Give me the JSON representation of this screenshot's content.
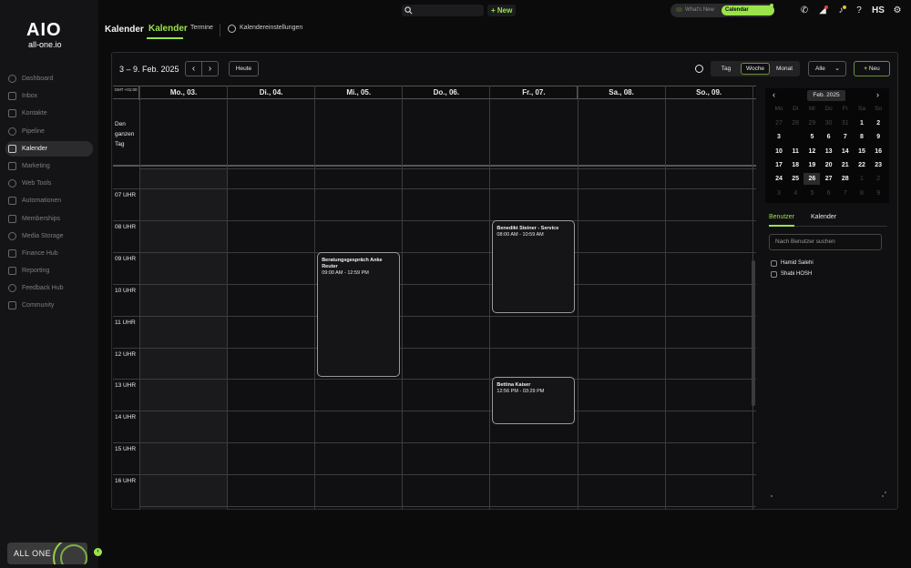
{
  "topbar": {
    "new_label": "+ New",
    "whats_new": "What's New",
    "calendar_updates": "Calendar Updates",
    "user_initials": "HS"
  },
  "sidebar": {
    "logo": "AIO",
    "logo_text": "all-one.io",
    "items": [
      {
        "label": "Dashboard",
        "icon": "dashboard-icon"
      },
      {
        "label": "Inbox",
        "icon": "inbox-icon"
      },
      {
        "label": "Kontakte",
        "icon": "contacts-icon"
      },
      {
        "label": "Pipeline",
        "icon": "pipeline-icon"
      },
      {
        "label": "Kalender",
        "icon": "calendar-icon",
        "active": true
      },
      {
        "label": "Marketing",
        "icon": "marketing-icon"
      },
      {
        "label": "Web Tools",
        "icon": "web-tools-icon"
      },
      {
        "label": "Automationen",
        "icon": "automation-icon"
      },
      {
        "label": "Memberships",
        "icon": "memberships-icon"
      },
      {
        "label": "Media Storage",
        "icon": "media-storage-icon"
      },
      {
        "label": "Finance Hub",
        "icon": "finance-icon"
      },
      {
        "label": "Reporting",
        "icon": "reporting-icon"
      },
      {
        "label": "Feedback Hub",
        "icon": "feedback-icon"
      },
      {
        "label": "Community",
        "icon": "community-icon"
      }
    ],
    "brand_footer": "ALL ONE"
  },
  "subnav": {
    "title": "Kalender",
    "tabs": [
      "Kalender",
      "Termine",
      "Kalendereinstellungen"
    ]
  },
  "toolbar": {
    "date_range": "3 – 9. Feb. 2025",
    "today": "Heute",
    "views": [
      "Tag",
      "Woche",
      "Monat"
    ],
    "active_view": "Woche",
    "filter": "Alle",
    "new": "Neu"
  },
  "grid": {
    "timezone": "GMT +01:00",
    "days": [
      "Mo., 03.",
      "Di., 04.",
      "Mi., 05.",
      "Do., 06.",
      "Fr., 07.",
      "Sa., 08.",
      "So., 09."
    ],
    "allday_label": "Den ganzen Tag",
    "hours": [
      "07 UHR",
      "08 UHR",
      "09 UHR",
      "10 UHR",
      "11 UHR",
      "12 UHR",
      "13 UHR",
      "14 UHR",
      "15 UHR",
      "16 UHR"
    ],
    "events": [
      {
        "title": "Beratungsgespräch Anke Reuter",
        "time": "09:00 AM - 12:59 PM",
        "day": "Mi., 05."
      },
      {
        "title": "Benedikt Steiner - Service",
        "time": "08:00 AM - 10:59 AM",
        "day": "Fr., 07."
      },
      {
        "title": "Bettina Kaiser",
        "time": "12:56 PM - 03:29 PM",
        "day": "Fr., 07."
      }
    ]
  },
  "mini_calendar": {
    "month": "Feb. 2025",
    "weekdays": [
      "Mo",
      "Di",
      "Mi",
      "Do",
      "Fr",
      "Sa",
      "So"
    ],
    "weeks": [
      [
        "27",
        "28",
        "29",
        "30",
        "31",
        "1",
        "2"
      ],
      [
        "3",
        "4",
        "5",
        "6",
        "7",
        "8",
        "9"
      ],
      [
        "10",
        "11",
        "12",
        "13",
        "14",
        "15",
        "16"
      ],
      [
        "17",
        "18",
        "19",
        "20",
        "21",
        "22",
        "23"
      ],
      [
        "24",
        "25",
        "26",
        "27",
        "28",
        "1",
        "2"
      ],
      [
        "3",
        "4",
        "5",
        "6",
        "7",
        "8",
        "9"
      ]
    ],
    "today": "4"
  },
  "right_panel": {
    "tabs": [
      "Benutzer",
      "Kalender"
    ],
    "search_placeholder": "Nach Benutzer suchen",
    "users": [
      "Hamid Salehi",
      "Shabi HOSH"
    ]
  },
  "colors": {
    "accent": "#9ae34a",
    "background": "#0b0b0c",
    "panel": "#101012"
  }
}
